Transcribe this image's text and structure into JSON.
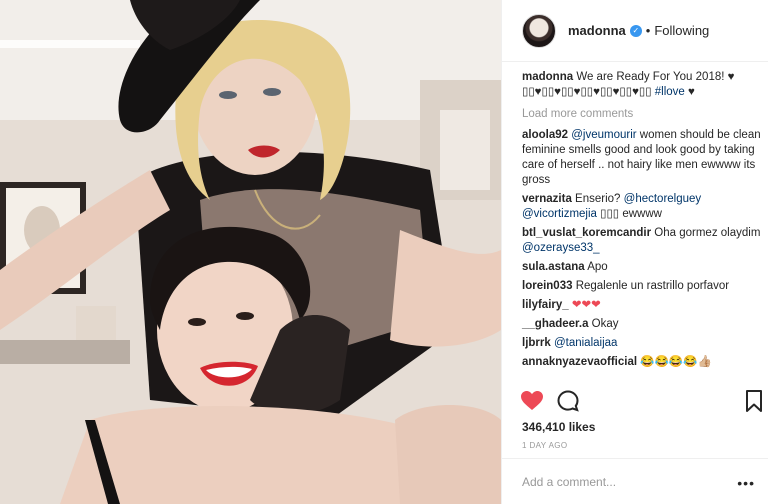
{
  "post": {
    "username": "madonna",
    "follow_status": "Following",
    "separator": "•",
    "caption": {
      "username": "madonna",
      "text": " We are Ready For You 2018! ♥ ▯▯♥▯▯♥▯▯♥▯▯♥▯▯♥▯▯♥▯▯ ",
      "hashtag": "#llove",
      "tail": " ♥"
    },
    "load_more": "Load more comments",
    "comments": [
      {
        "user": "aloola92",
        "mention": "@jveumourir",
        "text": " women should be clean feminine smells good and look good by taking care of herself .. not hairy like men ewwww its gross"
      },
      {
        "user": "vernazita",
        "text": " Enserio? ",
        "mention": "@hectorelguey",
        "mention2": "@vicortizmejia",
        "text2": " ▯▯▯ ewwww"
      },
      {
        "user": "btl_vuslat_koremcandir",
        "text": " Oha gormez olaydim ",
        "mention": "@ozerayse33_"
      },
      {
        "user": "sula.astana",
        "text": " Apo"
      },
      {
        "user": "lorein033",
        "text": " Regalenle un rastrillo porfavor"
      },
      {
        "user": "lilyfairy_",
        "text": " ❤❤❤"
      },
      {
        "user": "__ghadeer.a",
        "text": " Okay"
      },
      {
        "user": "ljbrrk",
        "mention": "@tanialaijaa"
      },
      {
        "user": "annaknyazevaofficial",
        "text": " 😂😂😂😂👍🏼"
      }
    ],
    "likes": "346,410 likes",
    "time_ago": "1 DAY AGO",
    "add_comment_placeholder": "Add a comment...",
    "more_options": "•••"
  },
  "colors": {
    "like_red": "#ed4956",
    "link_blue": "#003569",
    "muted_gray": "#999999",
    "verified_blue": "#3897f0"
  }
}
